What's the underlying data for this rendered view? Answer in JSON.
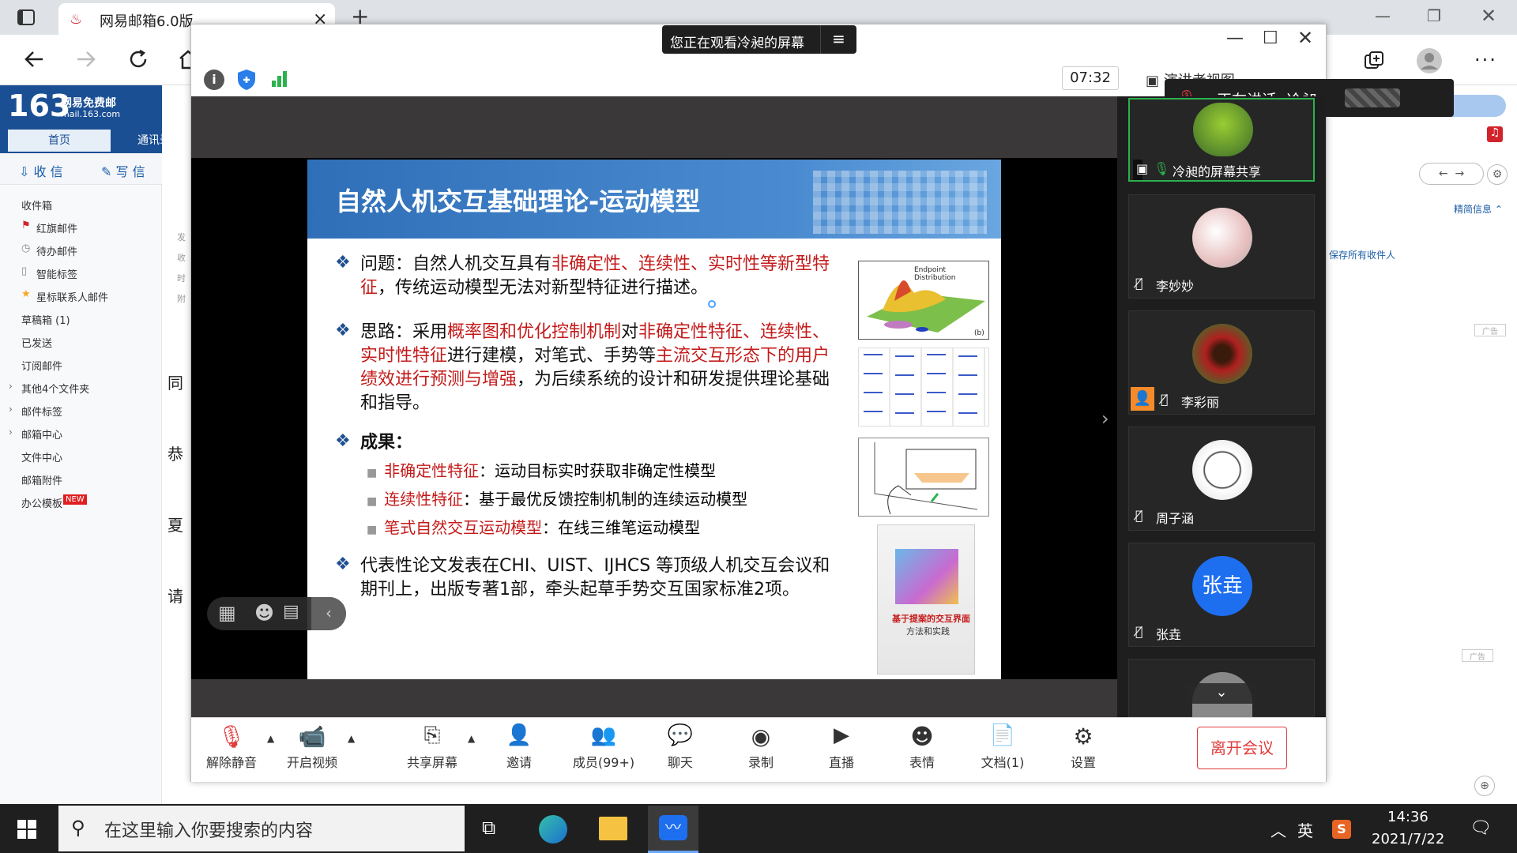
{
  "browser": {
    "tab_title": "网易邮箱6.0版",
    "close_tab": "×",
    "new_tab": "+"
  },
  "mail": {
    "logo_num": "163",
    "logo_line1": "网易免费邮",
    "logo_line2": "mail.163.com",
    "nav_home": "首页",
    "nav_contacts": "通讯录",
    "receive": "收 信",
    "write": "写 信",
    "folders": [
      "收件箱",
      "红旗邮件",
      "待办邮件",
      "智能标签",
      "星标联系人邮件",
      "草稿箱 (1)",
      "已发送",
      "订阅邮件",
      "其他4个文件夹",
      "邮件标签",
      "邮箱中心",
      "文件中心",
      "邮箱附件",
      "办公模板"
    ],
    "new_badge": "NEW",
    "right_brief": "精简信息",
    "right_save": "保存所有收件人",
    "ad1": "广告",
    "ad2": "广告",
    "left_chars": [
      "同",
      "恭",
      "夏",
      "请"
    ],
    "field_labels": [
      "发",
      "收",
      "时",
      "附"
    ]
  },
  "meeting": {
    "banner": "您正在观看冷昶的屏幕",
    "timer": "07:32",
    "view_label": "演讲者视图",
    "speaking": "正在讲话: 冷昶;",
    "participants": [
      {
        "name": "冷昶的屏幕共享"
      },
      {
        "name": "李妙妙"
      },
      {
        "name": "李彩丽"
      },
      {
        "name": "周子涵"
      },
      {
        "name": "张垚",
        "avatar_text": "张垚"
      }
    ],
    "toolbar": [
      "解除静音",
      "开启视频",
      "共享屏幕",
      "邀请",
      "成员(99+)",
      "聊天",
      "录制",
      "直播",
      "表情",
      "文档(1)",
      "设置"
    ],
    "leave": "离开会议"
  },
  "slide": {
    "title": "自然人机交互基础理论-运动模型",
    "p1_a": "问题：自然人机交互具有",
    "p1_red": "非确定性、连续性、实时性等新型特征",
    "p1_b": "，传统运动模型无法对新型特征进行描述。",
    "p2_a": "思路：采用",
    "p2_red1": "概率图和优化控制机制",
    "p2_b": "对",
    "p2_red2": "非确定性特征、连续性、实时性特征",
    "p2_c": "进行建模，对笔式、手势等",
    "p2_red3": "主流交互形态下的用户绩效进行预测与增强",
    "p2_d": "，为后续系统的设计和研发提供理论基础和指导。",
    "p3": "成果：",
    "s1_red": "非确定性特征",
    "s1": "：运动目标实时获取非确定性模型",
    "s2_red": "连续性特征",
    "s2": "：基于最优反馈控制机制的连续运动模型",
    "s3_red": "笔式自然交互运动模型",
    "s3": "：在线三维笔运动模型",
    "p4": "代表性论文发表在CHI、UIST、IJHCS 等顶级人机交互会议和期刊上，出版专著1部，牵头起草手势交互国家标准2项。",
    "fig_label": "Endpoint Distribution",
    "fig_b": "(b)",
    "book_title": "基于提案的交互界面",
    "book_sub": "方法和实践"
  },
  "taskbar": {
    "search_placeholder": "在这里输入你要搜索的内容",
    "ime": "英",
    "time": "14:36",
    "date": "2021/7/22"
  }
}
